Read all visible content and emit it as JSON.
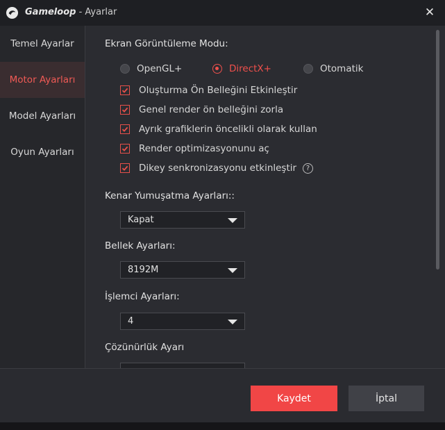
{
  "window": {
    "app_name": "Gameloop",
    "title_suffix": " - Ayarlar",
    "close_symbol": "✕"
  },
  "sidebar": {
    "items": [
      {
        "label": "Temel Ayarlar",
        "active": false
      },
      {
        "label": "Motor Ayarları",
        "active": true
      },
      {
        "label": "Model Ayarları",
        "active": false
      },
      {
        "label": "Oyun Ayarları",
        "active": false
      }
    ]
  },
  "display_mode": {
    "label": "Ekran Görüntüleme Modu:",
    "options": [
      {
        "label": "OpenGL+",
        "selected": false
      },
      {
        "label": "DirectX+",
        "selected": true
      },
      {
        "label": "Otomatik",
        "selected": false
      }
    ]
  },
  "checkboxes": [
    {
      "label": "Oluşturma Ön Belleğini Etkinleştir",
      "checked": true
    },
    {
      "label": "Genel render ön belleğini zorla",
      "checked": true
    },
    {
      "label": "Ayrık grafiklerin öncelikli olarak kullan",
      "checked": true
    },
    {
      "label": "Render optimizasyonunu aç",
      "checked": true
    },
    {
      "label": "Dikey senkronizasyonu etkinleştir",
      "checked": true,
      "help": "?"
    }
  ],
  "antialias": {
    "label": "Kenar Yumuşatma Ayarları::",
    "value": "Kapat"
  },
  "memory": {
    "label": "Bellek Ayarları:",
    "value": "8192M"
  },
  "cpu": {
    "label": "İşlemci Ayarları:",
    "value": "4"
  },
  "resolution": {
    "label": "Çözünürlük Ayarı",
    "value": ""
  },
  "footer": {
    "save_label": "Kaydet",
    "cancel_label": "İptal"
  },
  "colors": {
    "accent": "#f14646",
    "selected_text": "#f0504c",
    "background": "#2a2b30"
  },
  "icons": {
    "logo": "gameloop-logo-icon",
    "close": "close-icon",
    "check": "checkmark-icon",
    "dropdown": "chevron-down-icon",
    "help": "help-icon"
  }
}
